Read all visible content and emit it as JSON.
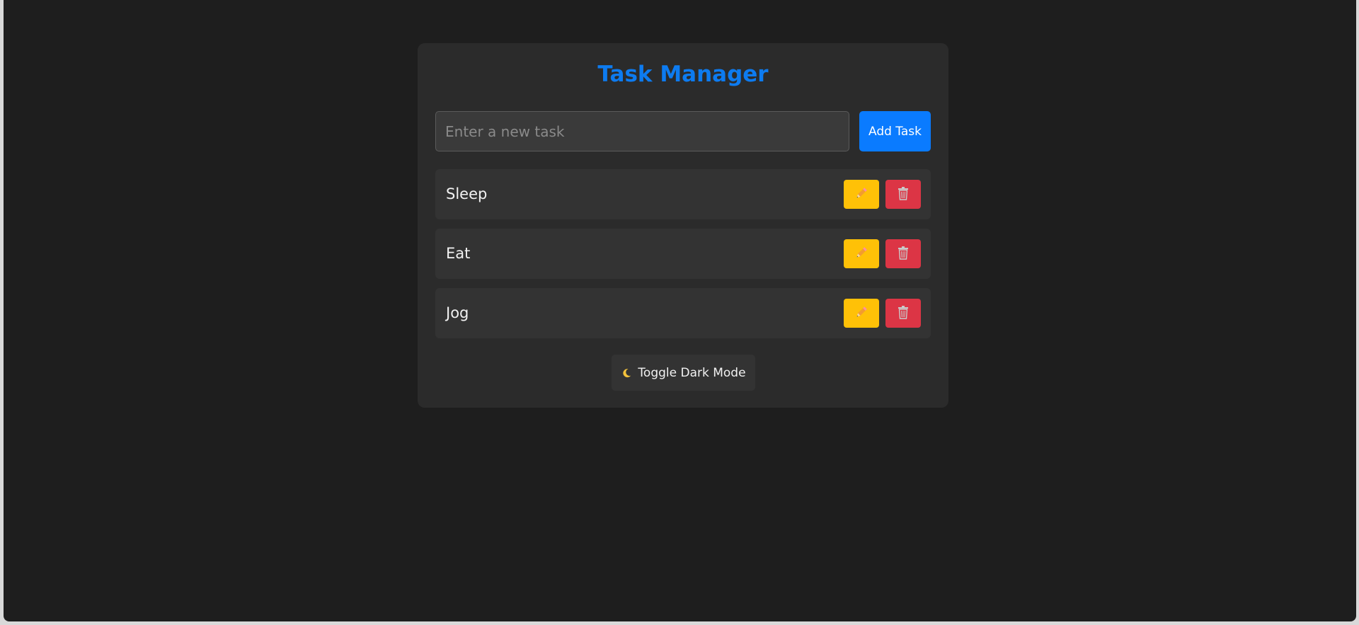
{
  "app": {
    "title": "Task Manager"
  },
  "input": {
    "value": "",
    "placeholder": "Enter a new task",
    "add_label": "Add Task"
  },
  "tasks": [
    {
      "label": "Sleep",
      "edit_icon": "pencil-icon",
      "delete_icon": "trash-icon"
    },
    {
      "label": "Eat",
      "edit_icon": "pencil-icon",
      "delete_icon": "trash-icon"
    },
    {
      "label": "Jog",
      "edit_icon": "pencil-icon",
      "delete_icon": "trash-icon"
    }
  ],
  "toggle": {
    "label": "Toggle Dark Mode",
    "icon": "moon-icon"
  },
  "colors": {
    "accent": "#0a7bff",
    "title": "#0d7bf0",
    "edit": "#ffc107",
    "delete": "#dc3545",
    "background": "#1e1e1e",
    "card": "#2b2b2b"
  }
}
